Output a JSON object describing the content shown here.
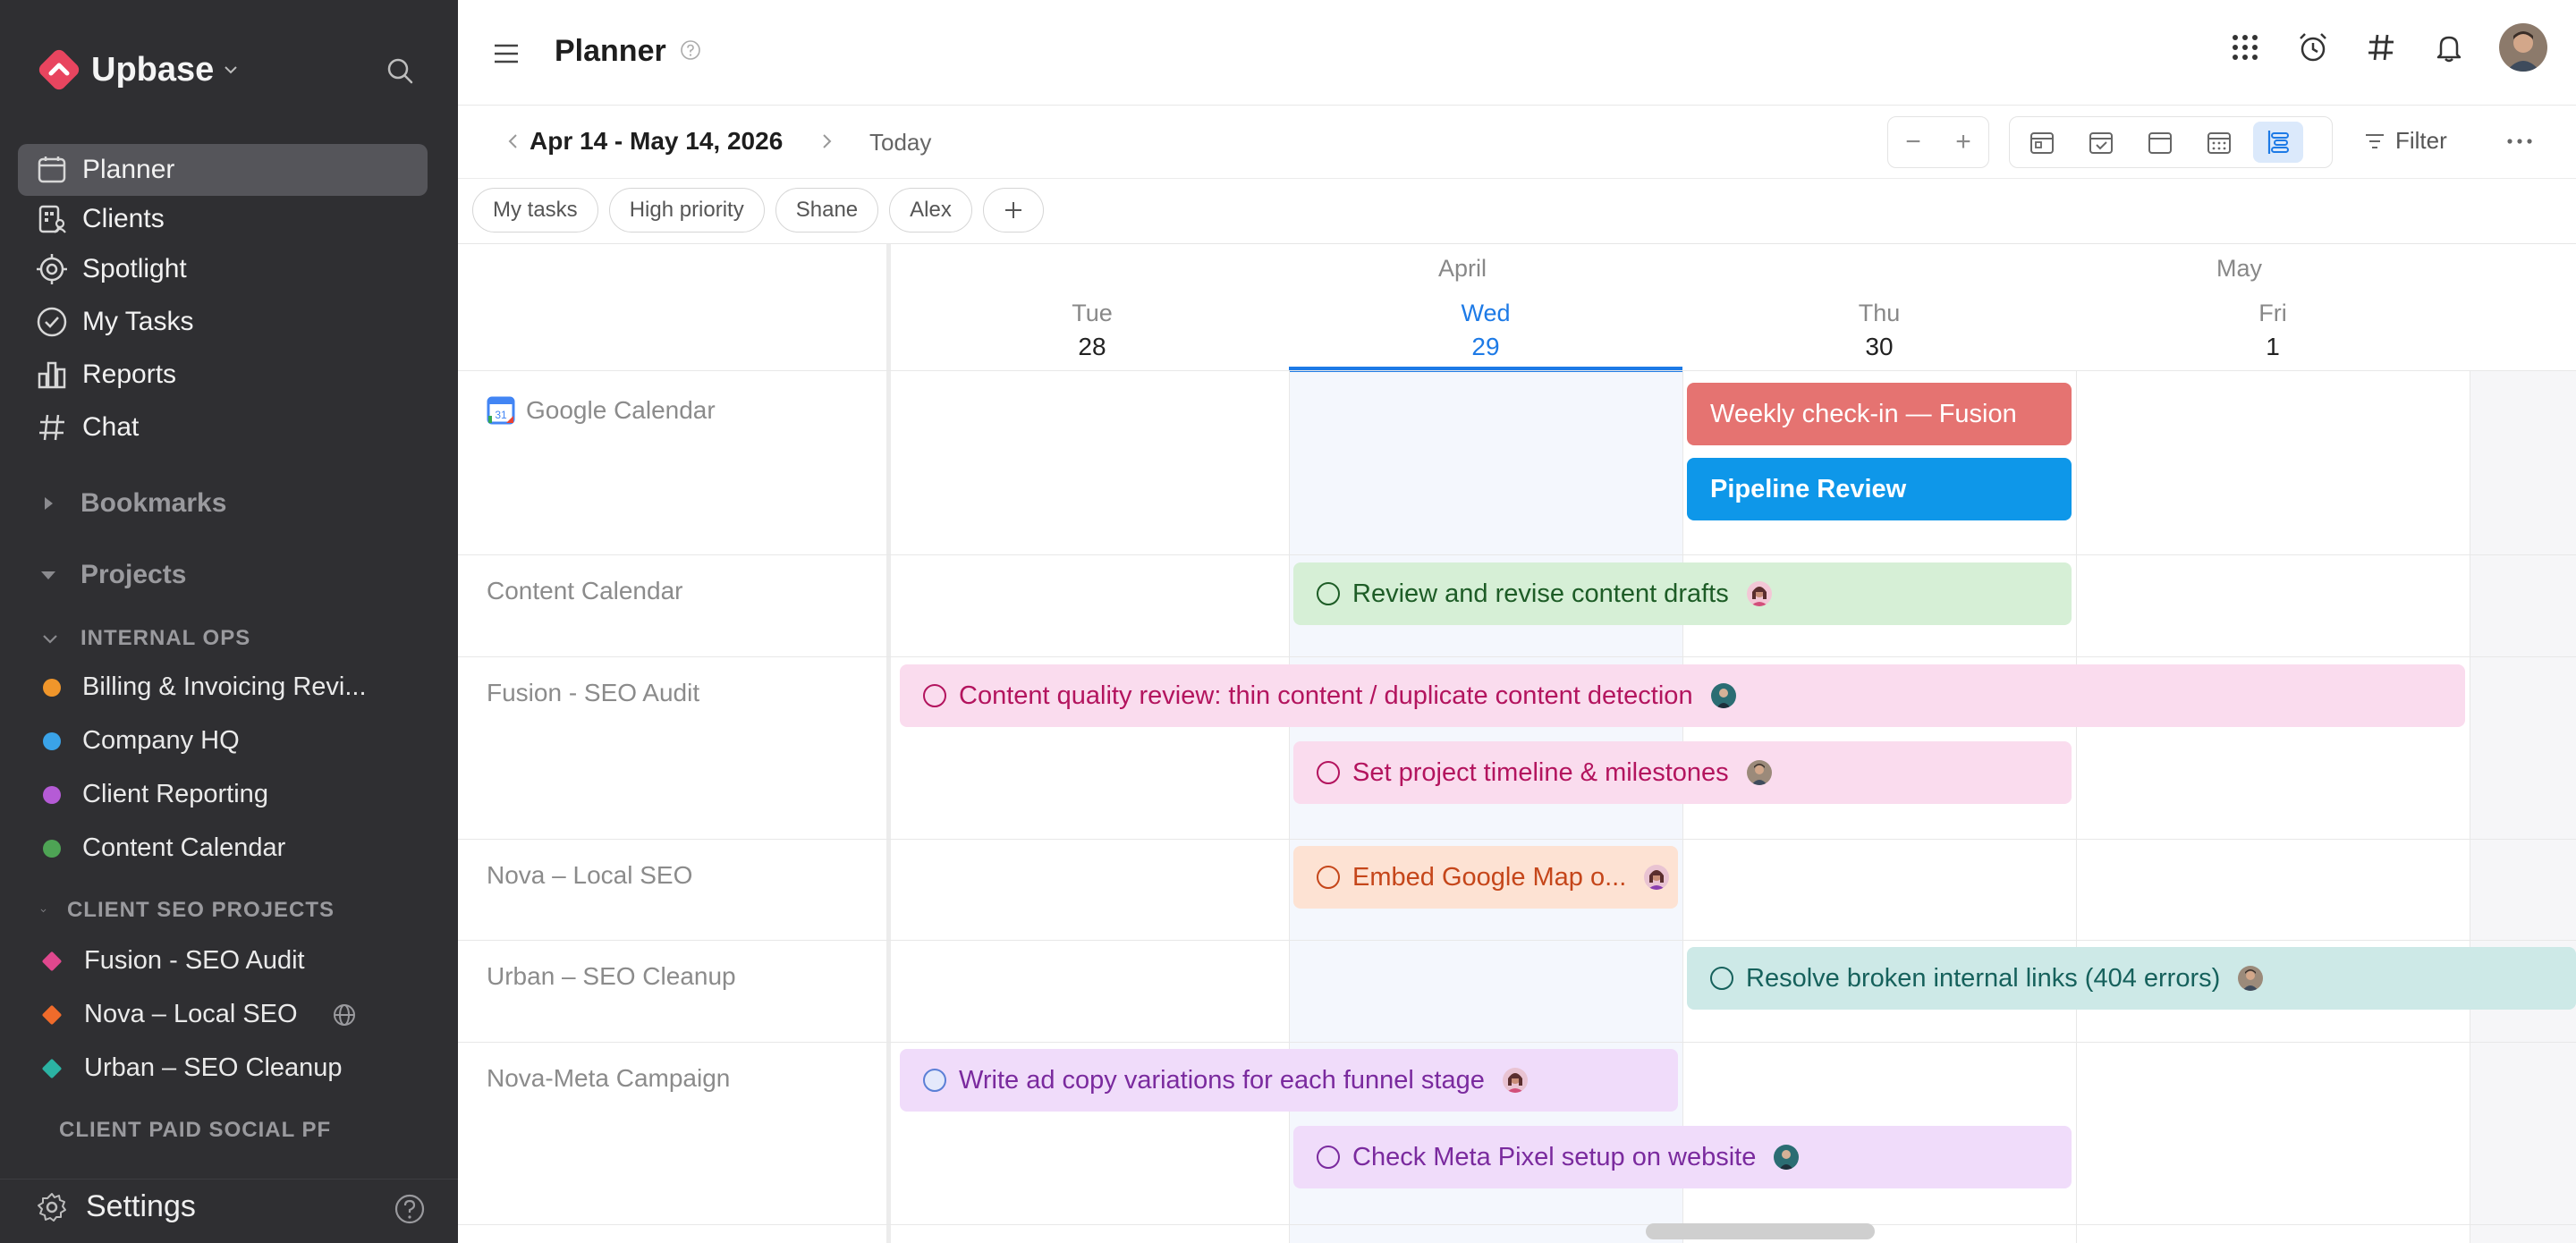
{
  "sidebar": {
    "brand": "Upbase",
    "nav": [
      {
        "label": "Planner",
        "icon": "planner-icon",
        "active": true
      },
      {
        "label": "Clients",
        "icon": "clients-icon"
      },
      {
        "label": "Spotlight",
        "icon": "spotlight-icon"
      },
      {
        "label": "My Tasks",
        "icon": "check-circle-icon"
      },
      {
        "label": "Reports",
        "icon": "bar-chart-icon"
      },
      {
        "label": "Chat",
        "icon": "hash-icon"
      }
    ],
    "bookmarks_label": "Bookmarks",
    "projects_label": "Projects",
    "groups": [
      {
        "title": "INTERNAL OPS",
        "items": [
          {
            "label": "Billing & Invoicing Revi...",
            "color": "#f0962b"
          },
          {
            "label": "Company HQ",
            "color": "#3aa3e8"
          },
          {
            "label": "Client Reporting",
            "color": "#b55bd6"
          },
          {
            "label": "Content Calendar",
            "color": "#4ea455"
          }
        ]
      },
      {
        "title": "CLIENT SEO PROJECTS",
        "items": [
          {
            "label": "Fusion - SEO Audit",
            "color": "#e0488e"
          },
          {
            "label": "Nova – Local SEO",
            "color": "#f06b2b"
          },
          {
            "label": "Urban – SEO Cleanup",
            "color": "#2bb3a3"
          }
        ]
      },
      {
        "title": "CLIENT PAID SOCIAL PF",
        "items": []
      }
    ],
    "settings_label": "Settings"
  },
  "header": {
    "title": "Planner"
  },
  "toolbar": {
    "date_range": "Apr 14 - May 14, 2026",
    "today_label": "Today",
    "zoom_out": "−",
    "zoom_in": "+",
    "filter_label": "Filter"
  },
  "chips": [
    "My tasks",
    "High priority",
    "Shane",
    "Alex"
  ],
  "calendar": {
    "months": [
      "April",
      "May"
    ],
    "days": [
      {
        "name": "Tue",
        "num": "28",
        "today": false
      },
      {
        "name": "Wed",
        "num": "29",
        "today": true
      },
      {
        "name": "Thu",
        "num": "30",
        "today": false
      },
      {
        "name": "Fri",
        "num": "1",
        "today": false
      }
    ],
    "rows": [
      "Google Calendar",
      "Content Calendar",
      "Fusion - SEO Audit",
      "Nova – Local SEO",
      "Urban – SEO Cleanup",
      "Nova-Meta Campaign"
    ],
    "events": {
      "weekly_checkin": "Weekly check-in — Fusion",
      "pipeline_review": "Pipeline Review",
      "review_drafts": "Review and revise content drafts",
      "content_quality": "Content quality review: thin content / duplicate content detection",
      "timeline": "Set project timeline & milestones",
      "embed_map": "Embed Google Map o...",
      "broken_links": "Resolve broken internal links (404 errors)",
      "ad_copy": "Write ad copy variations for each funnel stage",
      "meta_pixel": "Check Meta Pixel setup on website"
    }
  },
  "colors": {
    "sidebar_bg": "#2f2f32",
    "accent_blue": "#1d7ae6",
    "brand_red": "#e8455f"
  }
}
